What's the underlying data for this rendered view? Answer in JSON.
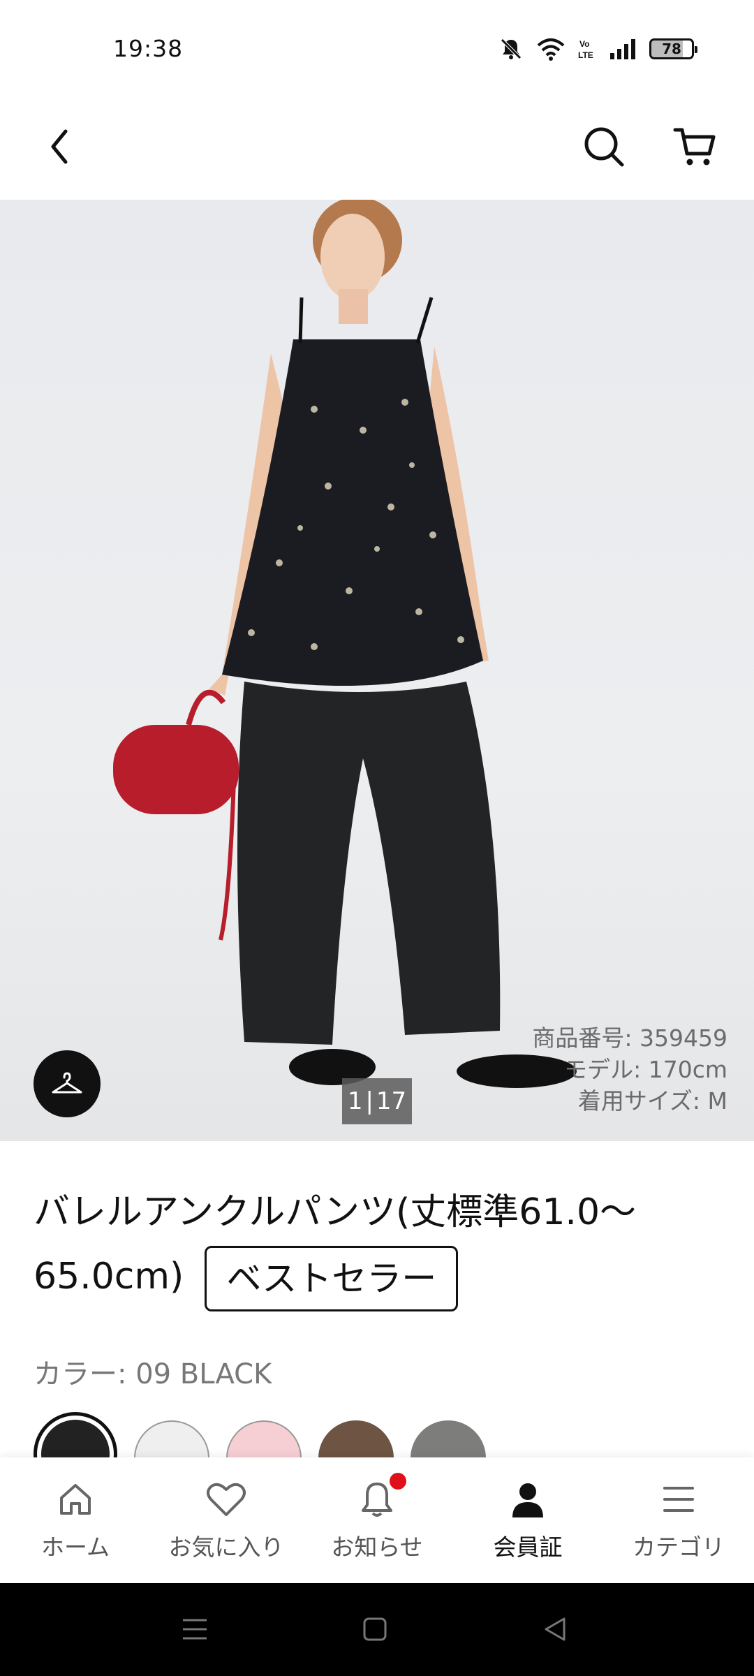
{
  "status": {
    "time": "19:38",
    "battery": "78"
  },
  "gallery": {
    "page_current": "1",
    "page_sep": "|",
    "page_total": "17",
    "meta": {
      "product_no": "商品番号:  359459",
      "model": "モデル: 170cm",
      "size": "着用サイズ: M"
    }
  },
  "product": {
    "title": "バレルアンクルパンツ(丈標準61.0〜65.0cm)",
    "badge": "ベストセラー",
    "color_label": "カラー: 09 BLACK"
  },
  "swatch_colors": [
    "#222222",
    "#efefef",
    "#f6cfd4",
    "#6e5443",
    "#7d7d7b"
  ],
  "nav": {
    "home": "ホーム",
    "favorites": "お気に入り",
    "notifications": "お知らせ",
    "member": "会員証",
    "category": "カテゴリ"
  },
  "colors": {
    "notification_dot": "#e0101a",
    "accent": "#111111"
  }
}
